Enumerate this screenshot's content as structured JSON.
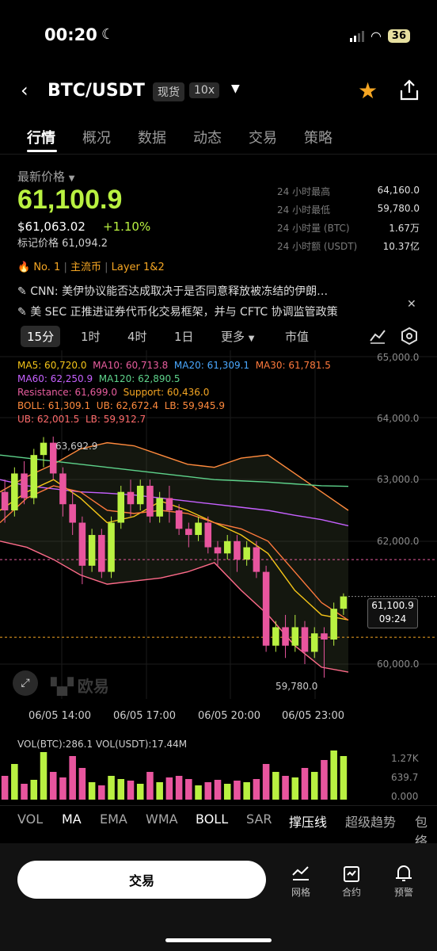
{
  "status": {
    "time": "00:20",
    "battery": "36"
  },
  "header": {
    "pair": "BTC/USDT",
    "spot_tag": "现货",
    "leverage_tag": "10x"
  },
  "tabs": [
    "行情",
    "概况",
    "数据",
    "动态",
    "交易",
    "策略"
  ],
  "ticker": {
    "latest_label": "最新价格",
    "price": "61,100.9",
    "usd_price": "$61,063.02",
    "change": "+1.10%",
    "mark_price": "标记价格 61,094.2",
    "stats": [
      {
        "k": "24 小时最高",
        "v": "64,160.0"
      },
      {
        "k": "24 小时最低",
        "v": "59,780.0"
      },
      {
        "k": "24 小时量 (BTC)",
        "v": "1.67万"
      },
      {
        "k": "24 小时额 (USDT)",
        "v": "10.37亿"
      }
    ],
    "badges": {
      "rank": "No. 1",
      "main": "主流币",
      "layer": "Layer 1&2"
    }
  },
  "news": [
    "CNN: 美伊协议能否达成取决于是否同意释放被冻结的伊朗…",
    "美 SEC 正推进证券代币化交易框架，并与 CFTC 协调监管政策"
  ],
  "timeframes": {
    "items": [
      "15分",
      "1时",
      "4时",
      "1日",
      "更多",
      "市值"
    ],
    "active": "15分"
  },
  "ma_lines": {
    "ma5": "MA5: 60,720.0",
    "ma10": "MA10: 60,713.8",
    "ma20": "MA20: 61,309.1",
    "ma30": "MA30: 61,781.5",
    "ma60": "MA60: 62,250.9",
    "ma120": "MA120: 62,890.5",
    "resistance": "Resistance: 61,699.0",
    "support": "Support: 60,436.0",
    "boll": "BOLL: 61,309.1",
    "ub": "UB: 62,672.4",
    "lb": "LB: 59,945.9",
    "ub2": "UB: 62,001.5",
    "lb2": "LB: 59,912.7"
  },
  "price_axis": [
    "65,000.0",
    "64,000.0",
    "63,000.0",
    "62,000.0",
    "60,000.0"
  ],
  "high_marker": "63,692.9",
  "low_marker": "59,780.0",
  "current_price_tag": {
    "price": "61,100.9",
    "countdown": "09:24"
  },
  "time_axis": [
    "06/05 14:00",
    "06/05 17:00",
    "06/05 20:00",
    "06/05 23:00"
  ],
  "watermark": "欧易",
  "volume": {
    "label": "VOL(BTC):286.1 VOL(USDT):17.44M",
    "axis": [
      "1.27K",
      "639.7",
      "0.000"
    ]
  },
  "indicators": [
    "VOL",
    "MA",
    "EMA",
    "WMA",
    "BOLL",
    "SAR",
    "撑压线",
    "超级趋势",
    "包络"
  ],
  "bottom": {
    "trade": "交易",
    "nav": [
      "网格",
      "合约",
      "预警"
    ]
  },
  "colors": {
    "up": "#b9f141",
    "down": "#e8559e",
    "accent": "#f5a623"
  }
}
